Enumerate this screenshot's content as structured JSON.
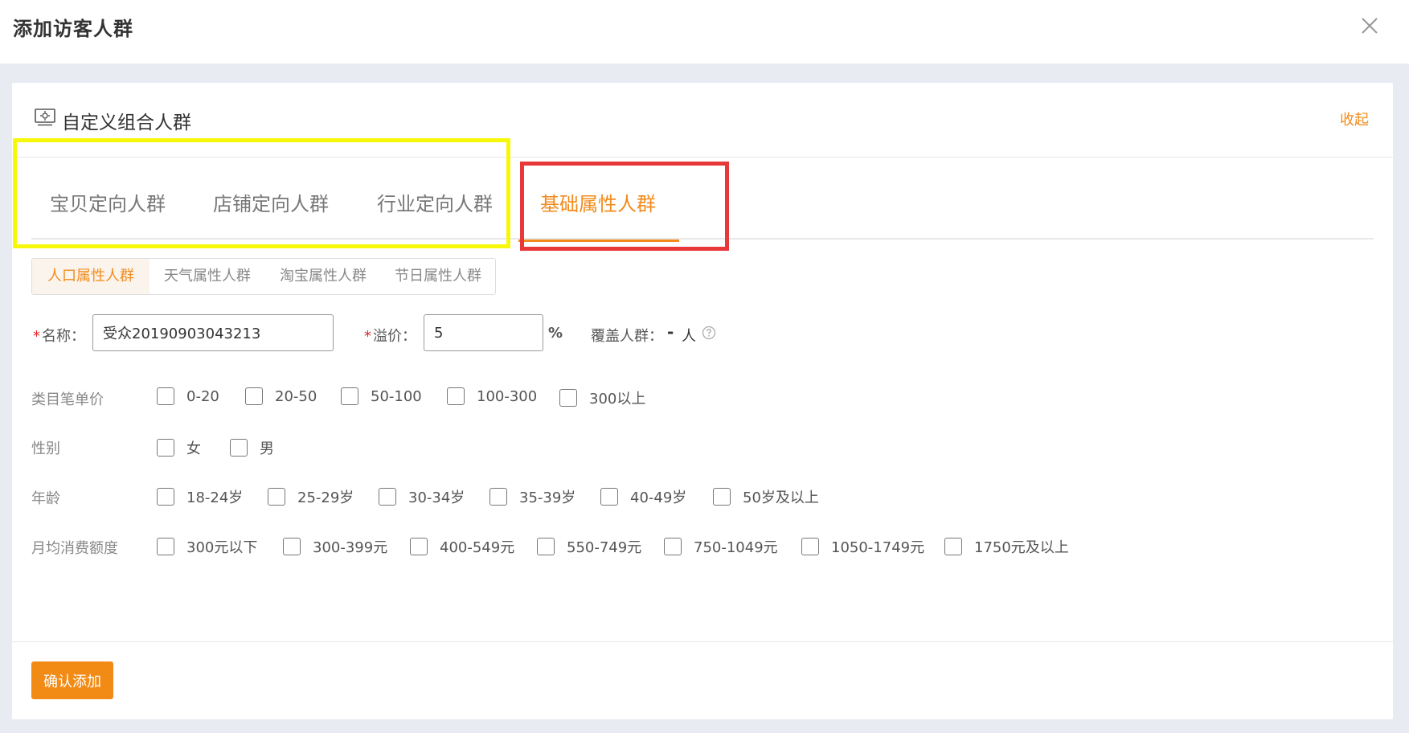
{
  "modal": {
    "title": "添加访客人群"
  },
  "card": {
    "title": "自定义组合人群",
    "collapse_label": "收起"
  },
  "main_tabs": [
    {
      "label": "宝贝定向人群"
    },
    {
      "label": "店铺定向人群"
    },
    {
      "label": "行业定向人群"
    },
    {
      "label": "基础属性人群"
    }
  ],
  "sub_tabs": [
    {
      "label": "人口属性人群"
    },
    {
      "label": "天气属性人群"
    },
    {
      "label": "淘宝属性人群"
    },
    {
      "label": "节日属性人群"
    }
  ],
  "form": {
    "required_mark": "*",
    "name_label": "名称：",
    "name_value": "受众20190903043213",
    "premium_label": "溢价：",
    "premium_value": "5",
    "premium_unit": "%",
    "coverage_label": "覆盖人群：",
    "coverage_value": "-",
    "coverage_unit": "人",
    "help_icon": "question-circle-icon"
  },
  "filters": {
    "price": {
      "label": "类目笔单价",
      "options": [
        "0-20",
        "20-50",
        "50-100",
        "100-300",
        "300以上"
      ]
    },
    "gender": {
      "label": "性别",
      "options": [
        "女",
        "男"
      ]
    },
    "age": {
      "label": "年龄",
      "options": [
        "18-24岁",
        "25-29岁",
        "30-34岁",
        "35-39岁",
        "40-49岁",
        "50岁及以上"
      ]
    },
    "spending": {
      "label": "月均消费额度",
      "options": [
        "300元以下",
        "300-399元",
        "400-549元",
        "550-749元",
        "750-1049元",
        "1050-1749元",
        "1750元及以上"
      ]
    }
  },
  "footer": {
    "confirm_label": "确认添加"
  },
  "colors": {
    "accent": "#f28b1c",
    "yellow_highlight": "#f7f70a",
    "red_highlight": "#e8383a"
  }
}
